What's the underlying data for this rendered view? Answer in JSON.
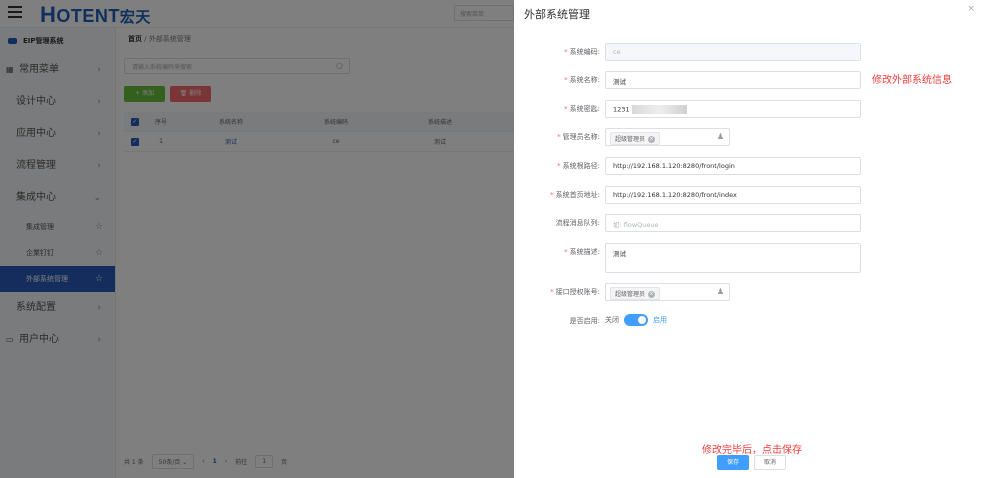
{
  "header": {
    "logo_initial": "H",
    "logo_text": "OTENT",
    "logo_cn": "宏天",
    "search_placeholder": "搜索菜单"
  },
  "sidebar": {
    "system_title": "EIP管理系统",
    "items": [
      {
        "label": "常用菜单",
        "icon": "grid-icon"
      },
      {
        "label": "设计中心"
      },
      {
        "label": "应用中心"
      },
      {
        "label": "流程管理"
      },
      {
        "label": "集成中心",
        "expanded": true
      },
      {
        "label": "系统配置"
      },
      {
        "label": "用户中心",
        "icon": "monitor-icon"
      }
    ],
    "subitems": [
      {
        "label": "集成管理"
      },
      {
        "label": "企業钉钉"
      },
      {
        "label": "外部系统管理",
        "active": true
      }
    ]
  },
  "main": {
    "breadcrumb_home": "首页",
    "breadcrumb_sep": "/",
    "breadcrumb_current": "外部系统管理",
    "search_placeholder": "请输入系统编码来搜索",
    "add_label": "+ 添加",
    "delete_label": "删除",
    "table": {
      "headers": [
        "序号",
        "系统名称",
        "系统编码",
        "系统描述"
      ],
      "rows": [
        {
          "no": "1",
          "name": "测试",
          "code": "ce",
          "desc": "测试"
        }
      ]
    },
    "pager": {
      "total": "共 1 条",
      "page_size": "50条/页",
      "current": "1",
      "goto": "前往",
      "goto_value": "1",
      "page_suffix": "页"
    }
  },
  "drawer": {
    "title": "外部系统管理",
    "close": "×",
    "fields": {
      "code_label": "系统编码:",
      "code_value": "ce",
      "name_label": "系统名称:",
      "name_value": "测试",
      "secret_label": "系统密匙:",
      "secret_value": "1231",
      "admin_label": "管理员名称:",
      "admin_tag": "超级管理员",
      "root_label": "系统根路径:",
      "root_value": "http://192.168.1.120:8280/front/login",
      "home_label": "系统首页地址:",
      "home_value": "http://192.168.1.120:8280/front/index",
      "queue_label": "流程消息队列:",
      "queue_placeholder": "如: flowQueue",
      "desc_label": "系统描述:",
      "desc_value": "测试",
      "account_label": "接口授权账号:",
      "account_tag": "超级管理员",
      "enabled_label": "是否启用:",
      "off_label": "关闭",
      "on_label": "启用"
    },
    "enabled": true,
    "annotation_edit": "修改外部系统信息",
    "annotation_save": "修改完毕后，点击保存",
    "save_label": "保存",
    "cancel_label": "取消"
  },
  "colors": {
    "brand": "#1f5fb8",
    "primary": "#409eff",
    "annotation": "#f03c3c",
    "success": "#67c23a",
    "danger": "#f56c6c"
  }
}
